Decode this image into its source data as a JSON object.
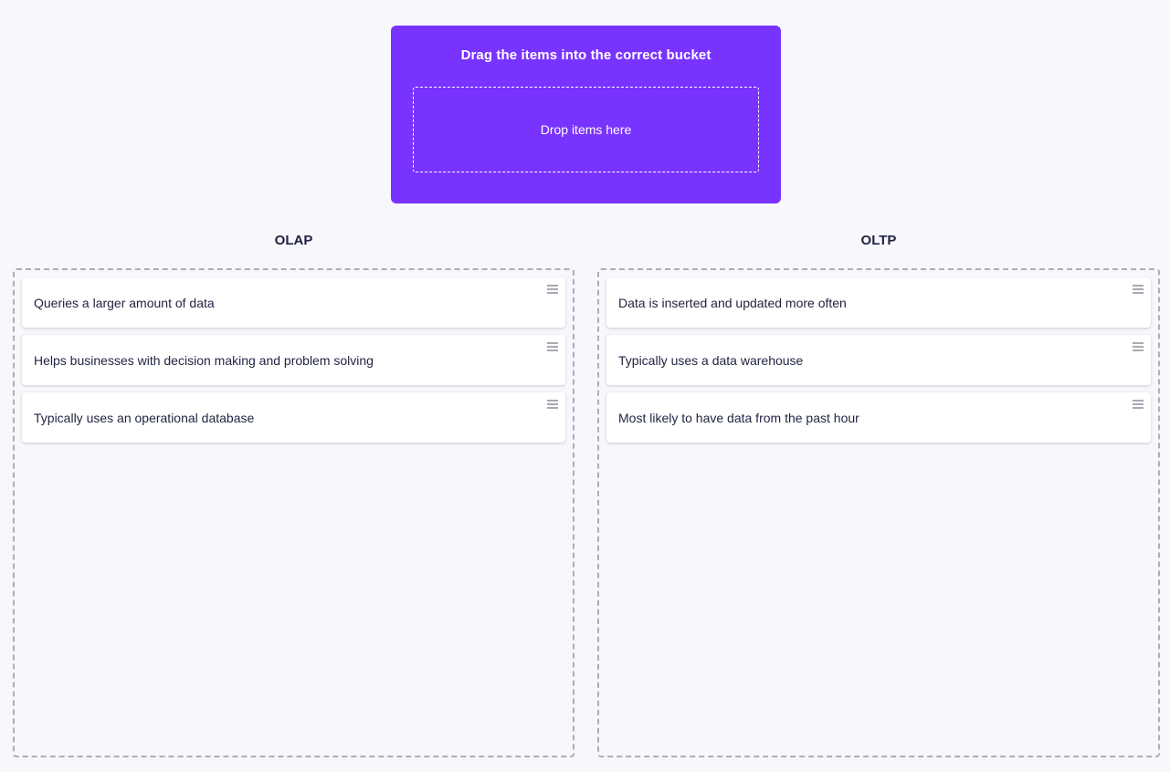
{
  "source": {
    "title": "Drag the items into the correct bucket",
    "dropzone_label": "Drop items here"
  },
  "buckets": [
    {
      "title": "OLAP",
      "items": [
        {
          "text": "Queries a larger amount of data"
        },
        {
          "text": "Helps businesses with decision making and problem solving"
        },
        {
          "text": "Typically uses an operational database"
        }
      ]
    },
    {
      "title": "OLTP",
      "items": [
        {
          "text": "Data is inserted and updated more often"
        },
        {
          "text": "Typically uses a data warehouse"
        },
        {
          "text": "Most likely to have data from the past hour"
        }
      ]
    }
  ],
  "colors": {
    "accent": "#7933ff",
    "background": "#f7f7fc",
    "text": "#1f2340"
  },
  "icons": {
    "drag_handle": "drag-handle-icon"
  }
}
